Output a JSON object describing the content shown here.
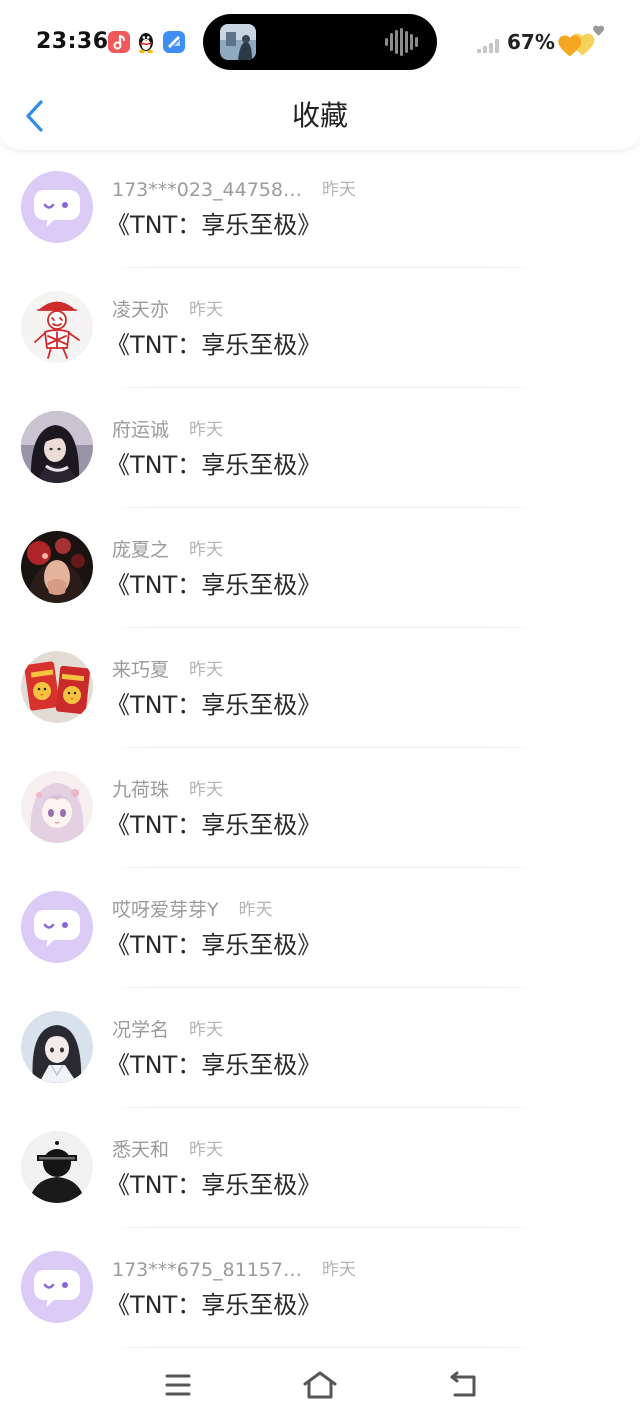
{
  "status_bar": {
    "time": "23:36",
    "battery": "67%",
    "icons": {
      "music_app": "music-app-icon",
      "qq": "qq-penguin-icon",
      "blue_app": "blue-app-icon",
      "now_playing": "album-thumbnail",
      "waveform": "audio-waveform-icon",
      "signal": "signal-icon",
      "battery": "heart-battery-icon"
    }
  },
  "header": {
    "back_icon": "chevron-left-icon",
    "title": "收藏"
  },
  "favorites": [
    {
      "name": "173***023_44758…",
      "time": "昨天",
      "title": "《TNT：享乐至极》",
      "avatar": "default-avatar-icon"
    },
    {
      "name": "凌天亦",
      "time": "昨天",
      "title": "《TNT：享乐至极》",
      "avatar": "photo-avatar"
    },
    {
      "name": "府运诚",
      "time": "昨天",
      "title": "《TNT：享乐至极》",
      "avatar": "photo-avatar"
    },
    {
      "name": "庞夏之",
      "time": "昨天",
      "title": "《TNT：享乐至极》",
      "avatar": "photo-avatar"
    },
    {
      "name": "来巧夏",
      "time": "昨天",
      "title": "《TNT：享乐至极》",
      "avatar": "photo-avatar"
    },
    {
      "name": "九荷珠",
      "time": "昨天",
      "title": "《TNT：享乐至极》",
      "avatar": "photo-avatar"
    },
    {
      "name": "哎呀爱芽芽Y",
      "time": "昨天",
      "title": "《TNT：享乐至极》",
      "avatar": "default-avatar-icon"
    },
    {
      "name": "况学名",
      "time": "昨天",
      "title": "《TNT：享乐至极》",
      "avatar": "photo-avatar"
    },
    {
      "name": "悉天和",
      "time": "昨天",
      "title": "《TNT：享乐至极》",
      "avatar": "photo-avatar"
    },
    {
      "name": "173***675_81157…",
      "time": "昨天",
      "title": "《TNT：享乐至极》",
      "avatar": "default-avatar-icon"
    }
  ],
  "nav_bar": {
    "icons": [
      "menu-icon",
      "home-icon",
      "back-icon"
    ]
  },
  "colors": {
    "accent": "#2f8ee8",
    "title_text": "#2a2a2a",
    "name_text": "#9b9b9b",
    "time_text": "#b4b4b4",
    "default_avatar_bg": "#dccbf6",
    "default_avatar_face": "#8a67d6",
    "background": "#ffffff"
  }
}
